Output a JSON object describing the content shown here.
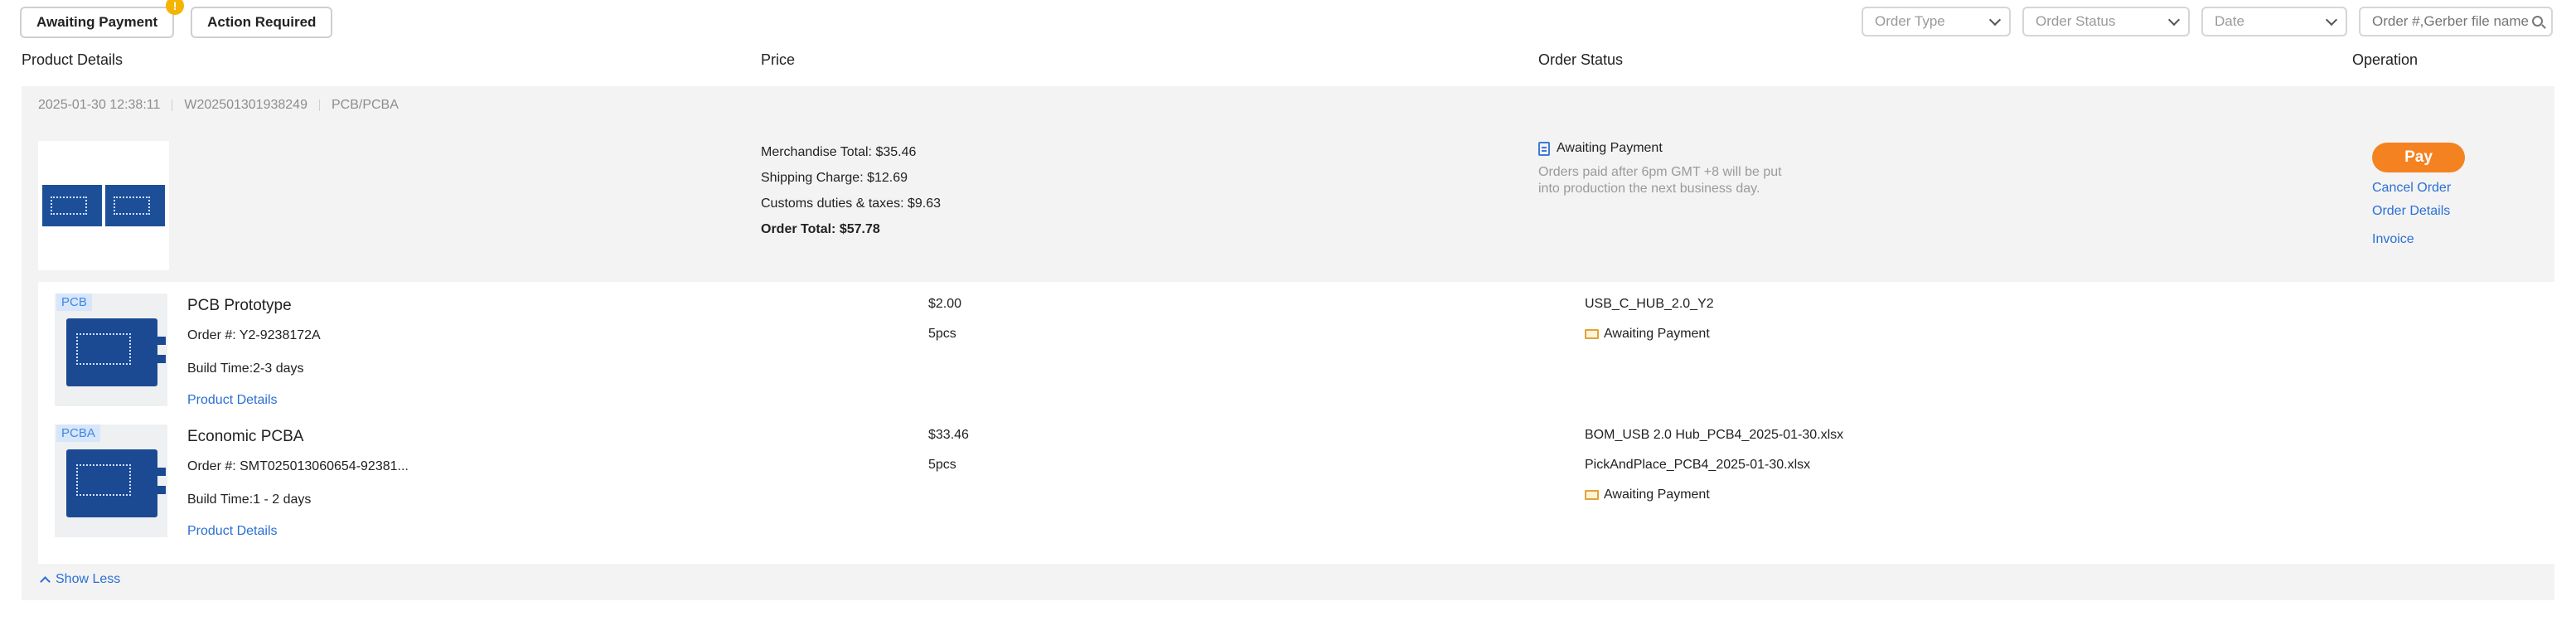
{
  "tabs": [
    {
      "label": "Awaiting Payment",
      "badge": "!"
    },
    {
      "label": "Action Required"
    }
  ],
  "filters": {
    "order_type": "Order Type",
    "order_status": "Order Status",
    "date": "Date",
    "search_placeholder": "Order #,Gerber file name..."
  },
  "columns": {
    "product_details": "Product Details",
    "price": "Price",
    "order_status": "Order Status",
    "operation": "Operation"
  },
  "order": {
    "datetime": "2025-01-30 12:38:11",
    "order_id": "W202501301938249",
    "type": "PCB/PCBA",
    "merchandise_total": "Merchandise Total: $35.46",
    "shipping_charge": "Shipping Charge: $12.69",
    "customs": "Customs duties & taxes: $9.63",
    "order_total": "Order Total: $57.78",
    "status": "Awaiting Payment",
    "note": "Orders paid after 6pm GMT +8 will be put into production the next business day.",
    "operations": {
      "pay": "Pay",
      "cancel": "Cancel Order",
      "details": "Order Details",
      "invoice": "Invoice"
    }
  },
  "items": [
    {
      "tag": "PCB",
      "title": "PCB Prototype",
      "order_no": "Order #: Y2-9238172A",
      "build_time": "Build Time:2-3 days",
      "details_link": "Product Details",
      "price": "$2.00",
      "qty": "5pcs",
      "file1": "USB_C_HUB_2.0_Y2",
      "status": "Awaiting Payment"
    },
    {
      "tag": "PCBA",
      "title": "Economic PCBA",
      "order_no": "Order #: SMT025013060654-92381...",
      "build_time": "Build Time:1 - 2 days",
      "details_link": "Product Details",
      "price": "$33.46",
      "qty": "5pcs",
      "file1": "BOM_USB 2.0 Hub_PCB4_2025-01-30.xlsx",
      "file2": "PickAndPlace_PCB4_2025-01-30.xlsx",
      "status": "Awaiting Payment"
    }
  ],
  "show_less": "Show Less",
  "colors": {
    "accent_orange": "#f58220",
    "link_blue": "#2b6fd4",
    "badge_yellow": "#f5b400",
    "card_bg": "#f3f3f3"
  }
}
